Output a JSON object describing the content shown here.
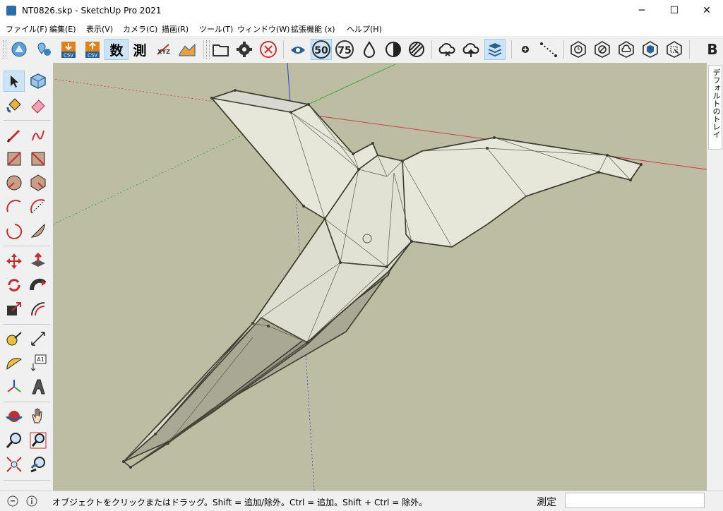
{
  "window": {
    "title": "NT0826.skp - SketchUp Pro 2021",
    "minimize": "─",
    "maximize": "☐",
    "close": "✕"
  },
  "menu": [
    "ファイル(F)",
    "編集(E)",
    "表示(V)",
    "カメラ(C)",
    "描画(R)",
    "ツール(T)",
    "ウィンドウ(W)",
    "拡張機能 (x)",
    "ヘルプ(H)"
  ],
  "toolbar": {
    "csv_label": "CSV",
    "count_label": "数",
    "measure_label": "測",
    "xyz_label": "XYZ",
    "shadow_50": "50",
    "shadow_75": "75",
    "brand_label": "B"
  },
  "tools": {
    "text_label": "A1"
  },
  "tray": {
    "label": "デフォルトのトレイ"
  },
  "status": {
    "text": "オブジェクトをクリックまたはドラッグ。Shift = 追加/除外。Ctrl = 追加。Shift + Ctrl = 除外。",
    "measure_label": "測定",
    "measure_value": ""
  },
  "colors": {
    "viewport_bg": "#bdbda4",
    "face": "#e6e6d9",
    "face_shaded": "#a8a894",
    "edge": "#3e3e30",
    "axis_red": "#d43030",
    "axis_green": "#30a830",
    "axis_blue": "#3040d0",
    "selected_tool_bg": "#cde4f7"
  }
}
